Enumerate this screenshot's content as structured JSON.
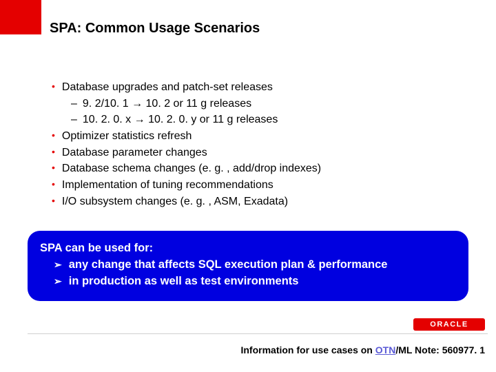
{
  "title": "SPA: Common Usage Scenarios",
  "bullets": [
    {
      "level": 1,
      "text": "Database upgrades and patch-set releases"
    },
    {
      "level": 2,
      "text": "9. 2/10. 1 → 10. 2 or 11 g releases"
    },
    {
      "level": 2,
      "text": "10. 2. 0. x → 10. 2. 0. y or 11 g releases"
    },
    {
      "level": 1,
      "text": "Optimizer statistics refresh"
    },
    {
      "level": 1,
      "text": "Database parameter changes"
    },
    {
      "level": 1,
      "text": "Database schema changes (e. g. , add/drop indexes)"
    },
    {
      "level": 1,
      "text": "Implementation of tuning recommendations"
    },
    {
      "level": 1,
      "text": "I/O subsystem changes (e. g. , ASM, Exadata)"
    }
  ],
  "callout": {
    "lead": "SPA can be used for:",
    "items": [
      "any change that affects SQL execution plan & performance",
      "in production as well as test environments"
    ]
  },
  "logo_text": "ORACLE",
  "footer": {
    "pre": "Information for use cases on ",
    "link": "OTN",
    "post": "/ML Note: 560977. 1"
  }
}
